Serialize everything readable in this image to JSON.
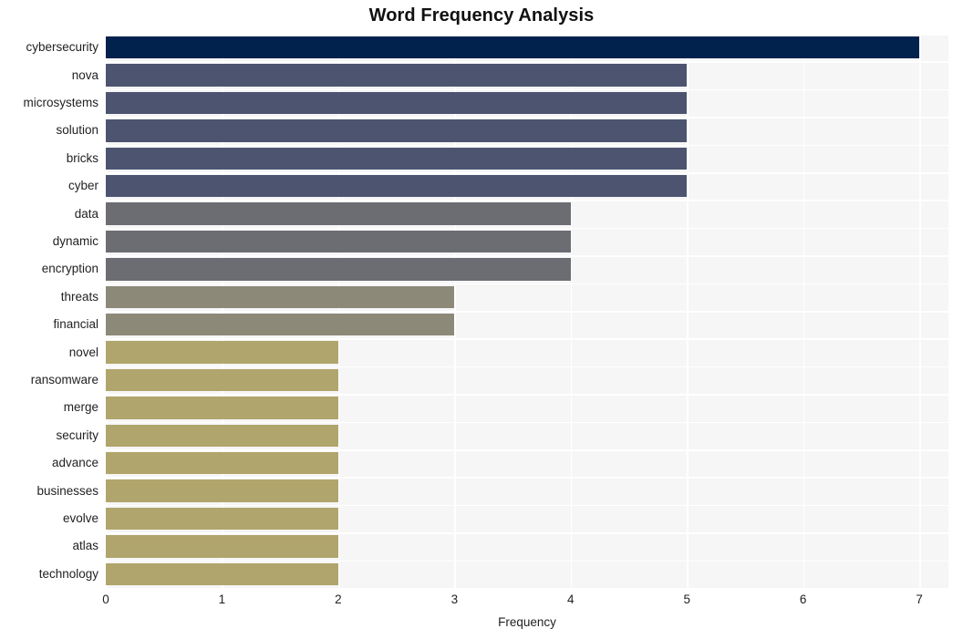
{
  "chart_data": {
    "type": "bar",
    "orientation": "horizontal",
    "title": "Word Frequency Analysis",
    "xlabel": "Frequency",
    "ylabel": "",
    "xlim": [
      0,
      7.25
    ],
    "xticks": [
      "0",
      "1",
      "2",
      "3",
      "4",
      "5",
      "6",
      "7"
    ],
    "xtick_values": [
      0,
      1,
      2,
      3,
      4,
      5,
      6,
      7
    ],
    "grid": true,
    "legend": null,
    "categories": [
      "cybersecurity",
      "nova",
      "microsystems",
      "solution",
      "bricks",
      "cyber",
      "data",
      "dynamic",
      "encryption",
      "threats",
      "financial",
      "novel",
      "ransomware",
      "merge",
      "security",
      "advance",
      "businesses",
      "evolve",
      "atlas",
      "technology"
    ],
    "values": [
      7,
      5,
      5,
      5,
      5,
      5,
      4,
      4,
      4,
      3,
      3,
      2,
      2,
      2,
      2,
      2,
      2,
      2,
      2,
      2
    ],
    "bar_colors": [
      "#02224e",
      "#4c5470",
      "#4c5470",
      "#4c5470",
      "#4c5470",
      "#4c5470",
      "#6b6d72",
      "#6b6d72",
      "#6b6d72",
      "#8d8979",
      "#8d8979",
      "#b0a56c",
      "#b0a56c",
      "#b0a56c",
      "#b0a56c",
      "#b0a56c",
      "#b0a56c",
      "#b0a56c",
      "#b0a56c",
      "#b0a56c"
    ],
    "plot_background": "#f6f6f7",
    "grid_color": "#ffffff",
    "figure_background": "#ffffff"
  }
}
